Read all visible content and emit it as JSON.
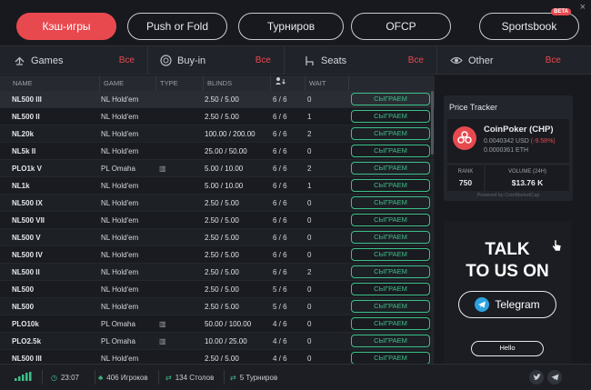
{
  "window": {
    "close_glyph": "×"
  },
  "tabs": [
    {
      "label": "Кэш-игры",
      "active": true
    },
    {
      "label": "Push or Fold",
      "active": false
    },
    {
      "label": "Турниров",
      "active": false
    },
    {
      "label": "OFCP",
      "active": false
    },
    {
      "label": "Sportsbook",
      "active": false,
      "badge": "BETA"
    }
  ],
  "filters": [
    {
      "label": "Games",
      "value": "Все",
      "icon": "spade-icon"
    },
    {
      "label": "Buy-in",
      "value": "Все",
      "icon": "chip-icon"
    },
    {
      "label": "Seats",
      "value": "Все",
      "icon": "seat-icon"
    },
    {
      "label": "Other",
      "value": "Все",
      "icon": "eye-icon"
    }
  ],
  "table": {
    "headers": [
      "NAME",
      "GAME",
      "TYPE",
      "BLINDS",
      "",
      "WAIT"
    ],
    "play_label": "СЫГРАЕМ",
    "rows": [
      {
        "name": "NL500 III",
        "game": "NL  Hold'em",
        "type": "",
        "blinds": "2.50 / 5.00",
        "seats": "6 / 6",
        "wait": "0"
      },
      {
        "name": "NL500 II",
        "game": "NL  Hold'em",
        "type": "",
        "blinds": "2.50 / 5.00",
        "seats": "6 / 6",
        "wait": "1"
      },
      {
        "name": "NL20k",
        "game": "NL  Hold'em",
        "type": "",
        "blinds": "100.00 / 200.00",
        "seats": "6 / 6",
        "wait": "2"
      },
      {
        "name": "NL5k II",
        "game": "NL  Hold'em",
        "type": "",
        "blinds": "25.00 / 50.00",
        "seats": "6 / 6",
        "wait": "0"
      },
      {
        "name": "PLO1k V",
        "game": "PL  Omaha",
        "type": "▥",
        "blinds": "5.00 / 10.00",
        "seats": "6 / 6",
        "wait": "2"
      },
      {
        "name": "NL1k",
        "game": "NL  Hold'em",
        "type": "",
        "blinds": "5.00 / 10.00",
        "seats": "6 / 6",
        "wait": "1"
      },
      {
        "name": "NL500 IX",
        "game": "NL  Hold'em",
        "type": "",
        "blinds": "2.50 / 5.00",
        "seats": "6 / 6",
        "wait": "0"
      },
      {
        "name": "NL500 VII",
        "game": "NL  Hold'em",
        "type": "",
        "blinds": "2.50 / 5.00",
        "seats": "6 / 6",
        "wait": "0"
      },
      {
        "name": "NL500 V",
        "game": "NL  Hold'em",
        "type": "",
        "blinds": "2.50 / 5.00",
        "seats": "6 / 6",
        "wait": "0"
      },
      {
        "name": "NL500 IV",
        "game": "NL  Hold'em",
        "type": "",
        "blinds": "2.50 / 5.00",
        "seats": "6 / 6",
        "wait": "0"
      },
      {
        "name": "NL500 II",
        "game": "NL  Hold'em",
        "type": "",
        "blinds": "2.50 / 5.00",
        "seats": "6 / 6",
        "wait": "2"
      },
      {
        "name": "NL500",
        "game": "NL  Hold'em",
        "type": "",
        "blinds": "2.50 / 5.00",
        "seats": "5 / 6",
        "wait": "0"
      },
      {
        "name": "NL500",
        "game": "NL  Hold'em",
        "type": "",
        "blinds": "2.50 / 5.00",
        "seats": "5 / 6",
        "wait": "0"
      },
      {
        "name": "PLO10k",
        "game": "PL  Omaha",
        "type": "▥",
        "blinds": "50.00 / 100.00",
        "seats": "4 / 6",
        "wait": "0"
      },
      {
        "name": "PLO2.5k",
        "game": "PL  Omaha",
        "type": "▥",
        "blinds": "10.00 / 25.00",
        "seats": "4 / 6",
        "wait": "0"
      },
      {
        "name": "NL500 III",
        "game": "NL  Hold'em",
        "type": "",
        "blinds": "2.50 / 5.00",
        "seats": "4 / 6",
        "wait": "0"
      }
    ]
  },
  "tracker": {
    "title": "Price Tracker",
    "coin_name": "CoinPoker (CHP)",
    "usd_value": "0.0040342 USD",
    "usd_change": "(-9.58%)",
    "eth_value": "0.0000361 ETH",
    "rank_label": "RANK",
    "rank_value": "750",
    "volume_label": "VOLUME (24H)",
    "volume_value": "$13.76 K",
    "powered_by": "Powered by CoinMarketCap"
  },
  "promo": {
    "line1": "TALK",
    "line2": "TO US ON",
    "telegram_label": "Telegram",
    "hello_label": "Hello"
  },
  "status": {
    "time": "23:07",
    "players": "406 Игроков",
    "tables": "134 Столов",
    "tournaments": "5 Турниров"
  },
  "colors": {
    "accent": "#e8494f",
    "play": "#3dbf8a",
    "telegram": "#2ba3df"
  }
}
